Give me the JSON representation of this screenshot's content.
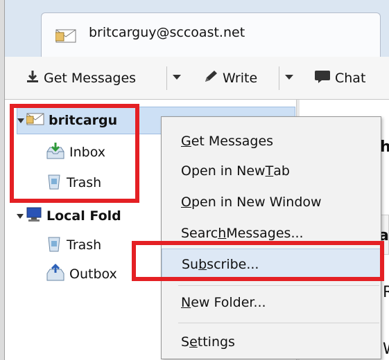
{
  "tab": {
    "title": "britcarguy@sccoast.net"
  },
  "toolbar": {
    "get_messages": "Get Messages",
    "write": "Write",
    "chat": "Chat"
  },
  "folders": {
    "account_name": "britcargu",
    "inbox": "Inbox",
    "trash": "Trash",
    "local_folders": "Local Fold",
    "local_trash": "Trash",
    "outbox": "Outbox"
  },
  "right_pane": {
    "heading_fragment": "h",
    "header_fragment": "a",
    "text_fragment_1": "R",
    "text_fragment_2": "W"
  },
  "context_menu": {
    "items": [
      {
        "pre": "",
        "key": "G",
        "post": "et Messages"
      },
      {
        "pre": "Open in New ",
        "key": "T",
        "post": "ab"
      },
      {
        "pre": "",
        "key": "O",
        "post": "pen in New Window"
      },
      {
        "pre": "Searc",
        "key": "h",
        "post": " Messages..."
      },
      {
        "pre": "Su",
        "key": "b",
        "post": "scribe..."
      },
      {
        "pre": "",
        "key": "N",
        "post": "ew Folder..."
      },
      {
        "pre": "S",
        "key": "e",
        "post": "ttings"
      }
    ]
  },
  "colors": {
    "highlight_box": "#e42024",
    "selection": "#cde0f5"
  },
  "icons": [
    "envelope-icon",
    "download-icon",
    "pencil-icon",
    "chat-bubble-icon",
    "inbox-icon",
    "trash-icon",
    "computer-icon",
    "outbox-icon"
  ]
}
